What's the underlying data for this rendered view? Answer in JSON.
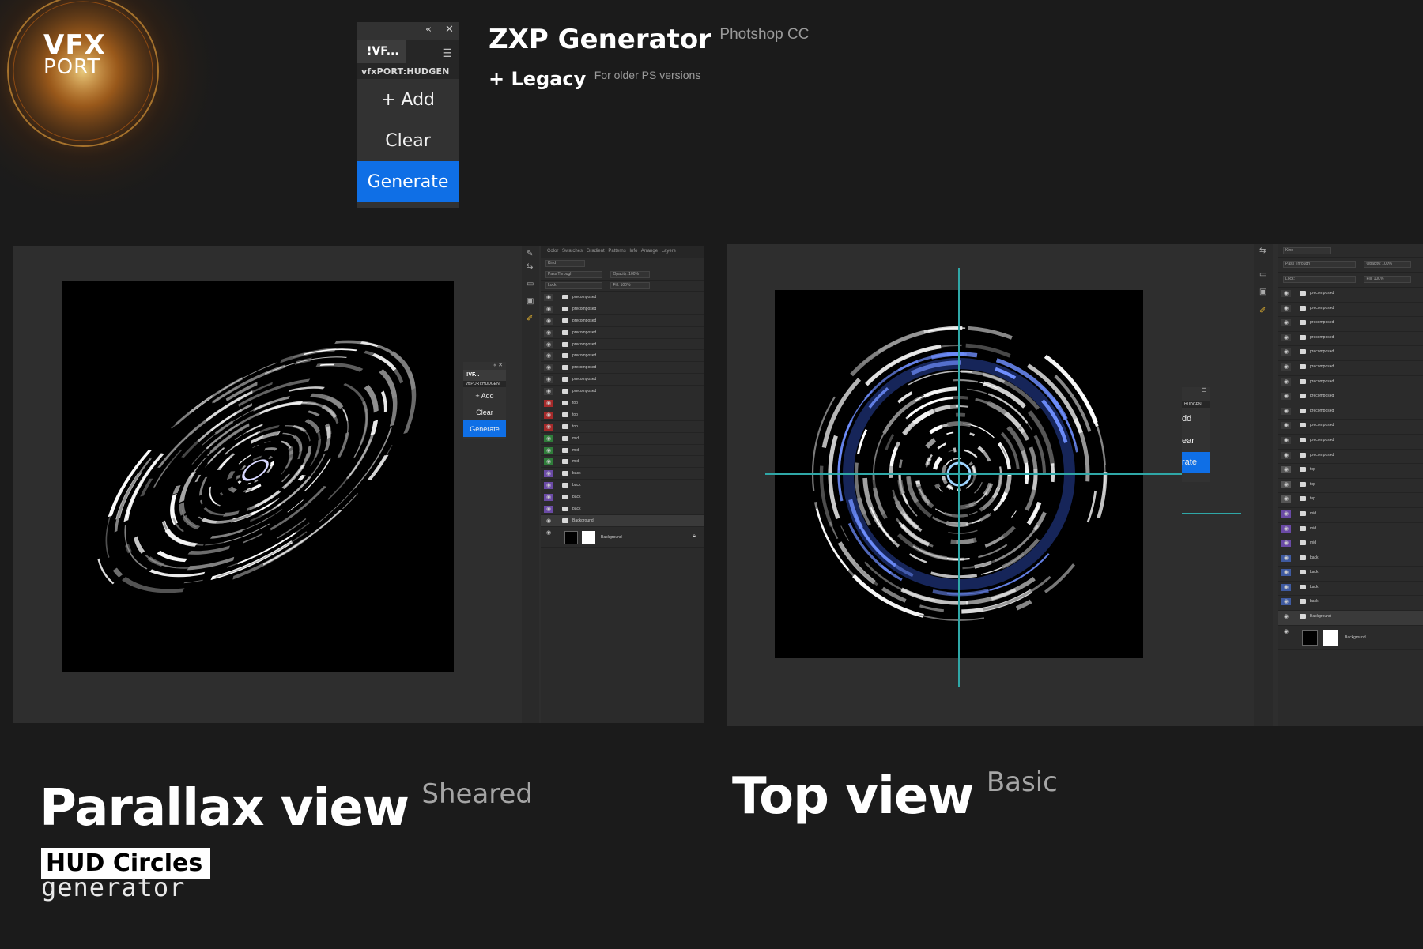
{
  "brand": {
    "logo_top": "VFX",
    "logo_bottom": "PORT"
  },
  "plugin_panel": {
    "tab_label": "!VF...",
    "subtitle": "vfxPORT:HUDGEN",
    "buttons": [
      "+ Add",
      "Clear",
      "Generate"
    ]
  },
  "headline": {
    "title": "ZXP Generator",
    "title_note": "Photshop CC",
    "legacy": "+ Legacy",
    "legacy_note": "For older  PS versions"
  },
  "left_view": {
    "title": "Parallax view",
    "note": "Sheared",
    "badge": "HUD Circles",
    "badge_sub": "generator",
    "mini_panel": {
      "tab_label": "!VF...",
      "subtitle": "vfxPORT:HUDGEN",
      "buttons": [
        "+ Add",
        "Clear",
        "Generate"
      ]
    },
    "layers_tabs": "Color Swatches Gradient Patterns Info Arrange Layers",
    "filter_kind": "Kind",
    "blend_mode": "Pass Through",
    "opacity": "Opacity: 100%",
    "fill": "Fill: 100%",
    "lock_label": "Lock:",
    "layers": [
      {
        "name": "precomposed",
        "eye": "#3a3a3a"
      },
      {
        "name": "precomposed",
        "eye": "#3a3a3a"
      },
      {
        "name": "precomposed",
        "eye": "#3a3a3a"
      },
      {
        "name": "precomposed",
        "eye": "#3a3a3a"
      },
      {
        "name": "precomposed",
        "eye": "#3a3a3a"
      },
      {
        "name": "precomposed",
        "eye": "#3a3a3a"
      },
      {
        "name": "precomposed",
        "eye": "#3a3a3a"
      },
      {
        "name": "precomposed",
        "eye": "#3a3a3a"
      },
      {
        "name": "precomposed",
        "eye": "#3a3a3a"
      },
      {
        "name": "top",
        "eye": "#a52a2a"
      },
      {
        "name": "top",
        "eye": "#a52a2a"
      },
      {
        "name": "top",
        "eye": "#a52a2a"
      },
      {
        "name": "mid",
        "eye": "#2f7d3a"
      },
      {
        "name": "mid",
        "eye": "#2f7d3a"
      },
      {
        "name": "mid",
        "eye": "#2f7d3a"
      },
      {
        "name": "back",
        "eye": "#6a4aa5"
      },
      {
        "name": "back",
        "eye": "#6a4aa5"
      },
      {
        "name": "back",
        "eye": "#6a4aa5"
      },
      {
        "name": "back",
        "eye": "#6a4aa5"
      },
      {
        "name": "Background",
        "eye": "#3a3a3a"
      }
    ],
    "background_layer": "Background"
  },
  "right_view": {
    "title": "Top view",
    "note": "Basic",
    "mini_panel": {
      "subtitle": "HUDGEN",
      "buttons": [
        "dd",
        "ear",
        "rate"
      ]
    },
    "filter_kind": "Kind",
    "blend_mode": "Pass Through",
    "opacity": "Opacity: 100%",
    "fill": "Fill: 100%",
    "lock_label": "Lock:",
    "layers": [
      {
        "name": "precomposed",
        "eye": "#3a3a3a"
      },
      {
        "name": "precomposed",
        "eye": "#3a3a3a"
      },
      {
        "name": "precomposed",
        "eye": "#3a3a3a"
      },
      {
        "name": "precomposed",
        "eye": "#3a3a3a"
      },
      {
        "name": "precomposed",
        "eye": "#3a3a3a"
      },
      {
        "name": "precomposed",
        "eye": "#3a3a3a"
      },
      {
        "name": "precomposed",
        "eye": "#3a3a3a"
      },
      {
        "name": "precomposed",
        "eye": "#3a3a3a"
      },
      {
        "name": "precomposed",
        "eye": "#3a3a3a"
      },
      {
        "name": "precomposed",
        "eye": "#3a3a3a"
      },
      {
        "name": "precomposed",
        "eye": "#3a3a3a"
      },
      {
        "name": "precomposed",
        "eye": "#3a3a3a"
      },
      {
        "name": "top",
        "eye": "#555555"
      },
      {
        "name": "top",
        "eye": "#555555"
      },
      {
        "name": "top",
        "eye": "#555555"
      },
      {
        "name": "mid",
        "eye": "#6a4aa5"
      },
      {
        "name": "mid",
        "eye": "#6a4aa5"
      },
      {
        "name": "mid",
        "eye": "#6a4aa5"
      },
      {
        "name": "back",
        "eye": "#3f5aa0"
      },
      {
        "name": "back",
        "eye": "#3f5aa0"
      },
      {
        "name": "back",
        "eye": "#3f5aa0"
      },
      {
        "name": "back",
        "eye": "#3f5aa0"
      },
      {
        "name": "Background",
        "eye": "#3a3a3a"
      }
    ],
    "background_layer": "Background"
  },
  "colors": {
    "accent": "#0f6fe6",
    "guide": "#2fa7a7",
    "background": "#1b1b1b"
  }
}
